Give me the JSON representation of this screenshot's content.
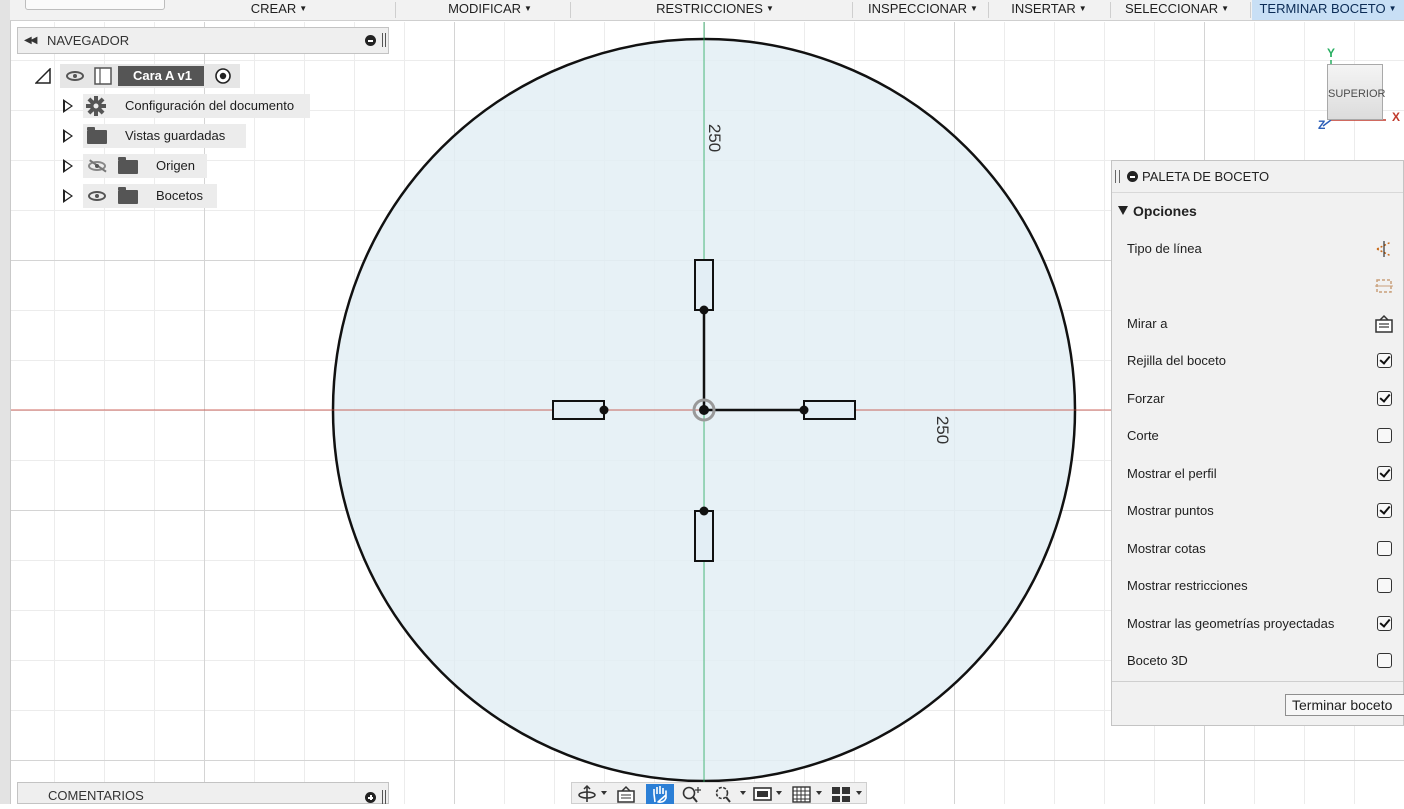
{
  "toolbar": {
    "menus": [
      {
        "label": "CREAR"
      },
      {
        "label": "MODIFICAR"
      },
      {
        "label": "RESTRICCIONES"
      },
      {
        "label": "INSPECCIONAR"
      },
      {
        "label": "INSERTAR"
      },
      {
        "label": "SELECCIONAR"
      },
      {
        "label": "TERMINAR BOCETO"
      }
    ]
  },
  "browser": {
    "title": "NAVEGADOR",
    "root": {
      "label": "Cara A v1"
    },
    "items": [
      {
        "label": "Configuración del documento",
        "icon": "gear-icon"
      },
      {
        "label": "Vistas guardadas",
        "icon": "folder-icon"
      },
      {
        "label": "Origen",
        "icon": "folder-icon",
        "visibility": "hidden"
      },
      {
        "label": "Bocetos",
        "icon": "folder-icon",
        "visibility": "visible"
      }
    ]
  },
  "canvas": {
    "dimensions": [
      "250",
      "250"
    ]
  },
  "viewcube": {
    "face": "SUPERIOR",
    "axes": {
      "x": "X",
      "y": "Y",
      "z": "Z"
    }
  },
  "palette": {
    "title": "PALETA DE BOCETO",
    "section": "Opciones",
    "options": [
      {
        "label": "Tipo de línea",
        "control": "icon",
        "icon": "construction-line-icon"
      },
      {
        "label": "",
        "control": "icon",
        "icon": "centerline-icon"
      },
      {
        "label": "Mirar a",
        "control": "icon",
        "icon": "look-at-icon"
      },
      {
        "label": "Rejilla del boceto",
        "control": "checkbox",
        "checked": true
      },
      {
        "label": "Forzar",
        "control": "checkbox",
        "checked": true
      },
      {
        "label": "Corte",
        "control": "checkbox",
        "checked": false
      },
      {
        "label": "Mostrar el perfil",
        "control": "checkbox",
        "checked": true
      },
      {
        "label": "Mostrar puntos",
        "control": "checkbox",
        "checked": true
      },
      {
        "label": "Mostrar cotas",
        "control": "checkbox",
        "checked": false
      },
      {
        "label": "Mostrar restricciones",
        "control": "checkbox",
        "checked": false
      },
      {
        "label": "Mostrar las geometrías proyectadas",
        "control": "checkbox",
        "checked": true
      },
      {
        "label": "Boceto 3D",
        "control": "checkbox",
        "checked": false
      }
    ],
    "finish_button": "Terminar boceto"
  },
  "comments": {
    "title": "COMENTARIOS"
  },
  "navbar": {
    "tools": [
      "orbit-icon",
      "look-at-icon",
      "pan-icon",
      "zoom-icon",
      "fit-icon",
      "display-settings-icon",
      "grid-icon",
      "viewports-icon"
    ],
    "active": "pan-icon"
  },
  "colors": {
    "profile_fill": "#e3eef5",
    "x_axis": "#c0392b",
    "y_axis": "#27ae60",
    "active_menu": "#c8dff5",
    "active_tool": "#2b7fd6"
  }
}
